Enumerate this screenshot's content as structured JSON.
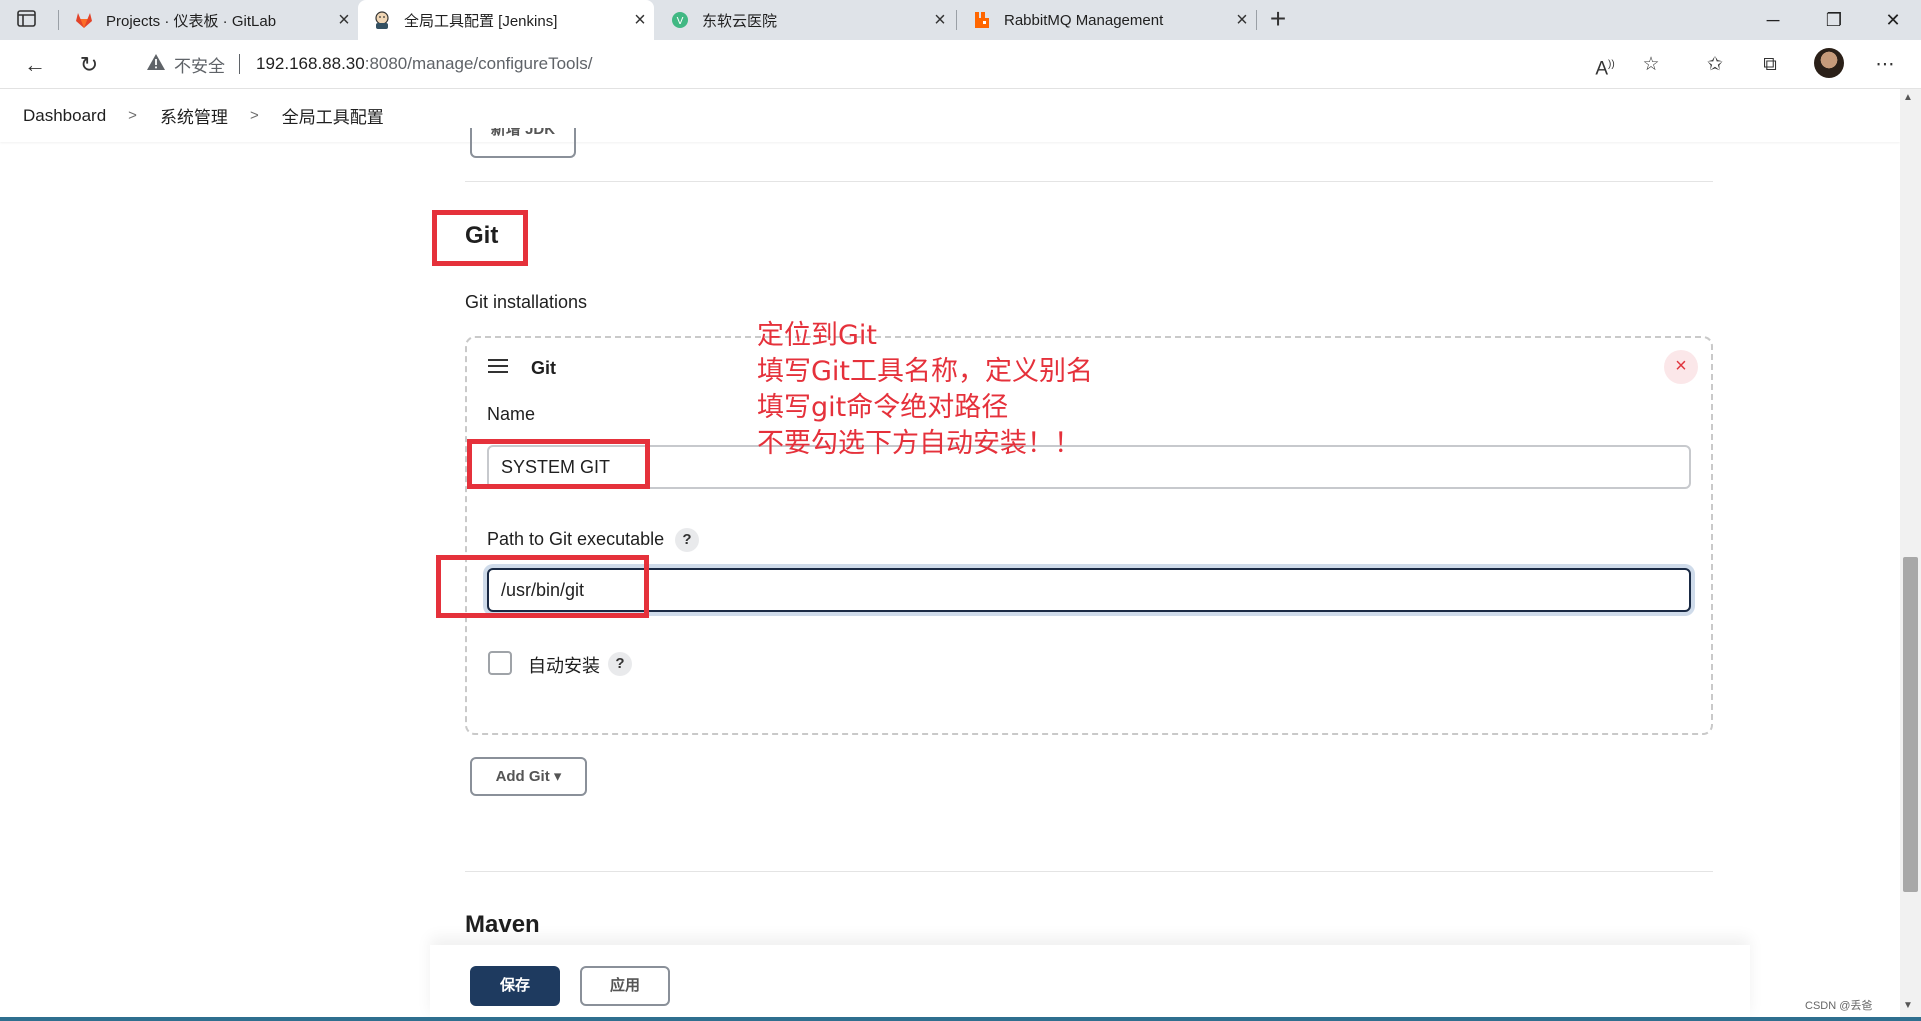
{
  "browser": {
    "tabs": [
      {
        "title": "Projects · 仪表板 · GitLab",
        "favicon": "gitlab-icon",
        "active": false
      },
      {
        "title": "全局工具配置 [Jenkins]",
        "favicon": "jenkins-icon",
        "active": true
      },
      {
        "title": "东软云医院",
        "favicon": "vue-icon",
        "active": false
      },
      {
        "title": "RabbitMQ Management",
        "favicon": "rabbitmq-icon",
        "active": false
      }
    ],
    "address": {
      "insecure_label": "不安全",
      "host": "192.168.88.30",
      "path": ":8080/manage/configureTools/"
    }
  },
  "breadcrumbs": [
    "Dashboard",
    "系统管理",
    "全局工具配置"
  ],
  "jdk": {
    "add_label": "新增 JDK"
  },
  "git_section": {
    "title": "Git",
    "installations_label": "Git installations",
    "item": {
      "title": "Git",
      "delete_symbol": "×",
      "name_label": "Name",
      "name_value": "SYSTEM GIT",
      "path_label": "Path to Git executable",
      "path_value": "/usr/bin/git",
      "auto_install_label": "自动安装",
      "help_symbol": "?"
    },
    "add_label": "Add Git"
  },
  "maven_section": {
    "title": "Maven"
  },
  "actions": {
    "save_label": "保存",
    "apply_label": "应用"
  },
  "annotation": {
    "lines": [
      "定位到Git",
      "填写Git工具名称，定义别名",
      "填写git命令绝对路径",
      "不要勾选下方自动安装！！"
    ]
  },
  "watermark": "CSDN @丢爸",
  "colors": {
    "annotation": "#e5313b",
    "primary_button": "#1e3a5f",
    "delete": "#e0363f"
  }
}
